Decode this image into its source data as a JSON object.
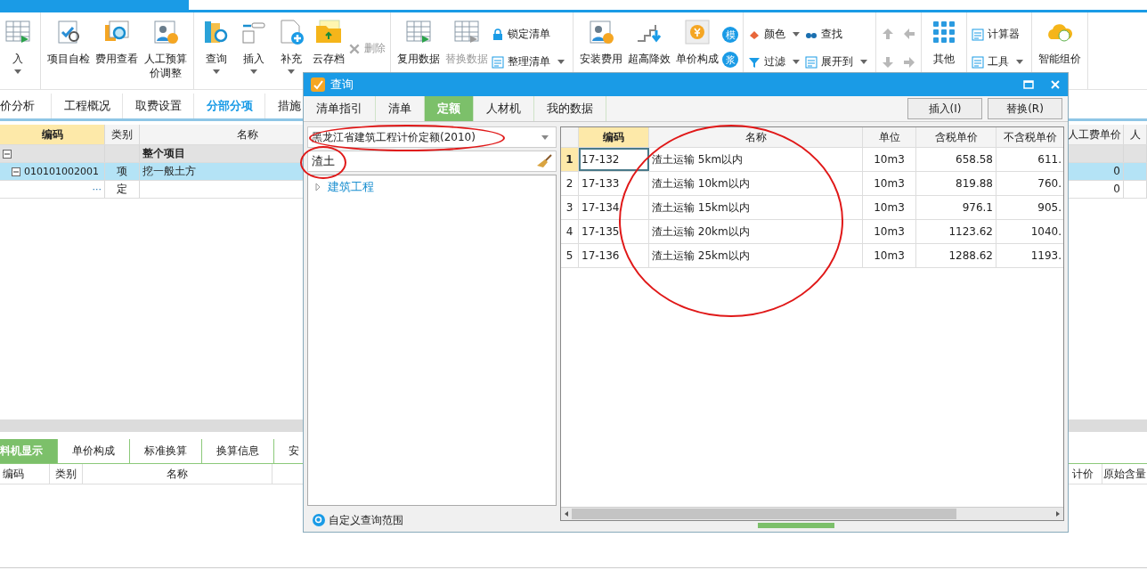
{
  "ribbon": {
    "groups": [
      {
        "items": [
          {
            "kind": "large",
            "label": "入",
            "dropdown": true,
            "disabled": false
          }
        ]
      },
      {
        "items": [
          {
            "kind": "large",
            "label": "项目自检",
            "dropdown": false,
            "disabled": false
          },
          {
            "kind": "large",
            "label": "费用查看",
            "dropdown": false,
            "disabled": false
          },
          {
            "kind": "large",
            "label": "人工预算价调整",
            "dropdown": false,
            "disabled": false
          }
        ]
      },
      {
        "items": [
          {
            "kind": "large",
            "label": "查询",
            "dropdown": true,
            "disabled": false
          },
          {
            "kind": "large",
            "label": "插入",
            "dropdown": true,
            "disabled": false
          },
          {
            "kind": "large",
            "label": "补充",
            "dropdown": true,
            "disabled": false
          },
          {
            "kind": "large",
            "label": "云存档",
            "dropdown": false,
            "disabled": false
          },
          {
            "kind": "small",
            "label": "删除",
            "disabled": true
          }
        ]
      },
      {
        "items": [
          {
            "kind": "large",
            "label": "复用数据",
            "dropdown": false,
            "disabled": false
          },
          {
            "kind": "large",
            "label": "替换数据",
            "dropdown": false,
            "disabled": true
          },
          {
            "kind": "stack",
            "buttons": [
              {
                "label": "锁定清单",
                "dropdown": false
              },
              {
                "label": "整理清单",
                "dropdown": true
              }
            ]
          }
        ]
      },
      {
        "items": [
          {
            "kind": "large",
            "label": "安装费用",
            "dropdown": false,
            "disabled": false
          },
          {
            "kind": "large",
            "label": "超高降效",
            "dropdown": false,
            "disabled": false
          },
          {
            "kind": "large",
            "label": "单价构成",
            "dropdown": false,
            "disabled": false
          },
          {
            "kind": "badges",
            "marks": [
              "模",
              "浆"
            ]
          }
        ]
      },
      {
        "items": [
          {
            "kind": "stack",
            "buttons": [
              {
                "label": "颜色",
                "dropdown": true
              },
              {
                "label": "过滤",
                "dropdown": true
              }
            ]
          },
          {
            "kind": "stack",
            "buttons": [
              {
                "label": "查找",
                "dropdown": false
              },
              {
                "label": "展开到",
                "dropdown": true
              }
            ]
          }
        ]
      },
      {
        "items": [
          {
            "kind": "arrows"
          }
        ]
      },
      {
        "items": [
          {
            "kind": "large",
            "label": "其他",
            "dropdown": false,
            "disabled": false
          }
        ]
      },
      {
        "items": [
          {
            "kind": "stack",
            "buttons": [
              {
                "label": "计算器",
                "dropdown": false
              },
              {
                "label": "工具",
                "dropdown": true
              }
            ]
          }
        ]
      },
      {
        "items": [
          {
            "kind": "large",
            "label": "智能组价",
            "dropdown": false,
            "disabled": false
          }
        ]
      }
    ]
  },
  "tabs": [
    {
      "label": "价分析",
      "selected": false
    },
    {
      "label": "工程概况",
      "selected": false
    },
    {
      "label": "取费设置",
      "selected": false
    },
    {
      "label": "分部分项",
      "selected": true
    },
    {
      "label": "措施",
      "selected": false
    }
  ],
  "grid": {
    "columns": [
      "编码",
      "类别",
      "名称",
      "人工费单价",
      "人"
    ],
    "rows": [
      {
        "kind": "root",
        "name": "整个项目",
        "expanded": true,
        "selected": false
      },
      {
        "kind": "item",
        "code": "010101002001",
        "type": "项",
        "name": "挖一般土方",
        "labor": "0",
        "expanded": true,
        "selected": true
      },
      {
        "kind": "quota",
        "code": "···",
        "type": "定",
        "labor": "0",
        "selected": false
      }
    ]
  },
  "bottom_tabs": [
    {
      "label": "料机显示",
      "selected": true
    },
    {
      "label": "单价构成",
      "selected": false
    },
    {
      "label": "标准换算",
      "selected": false
    },
    {
      "label": "换算信息",
      "selected": false
    },
    {
      "label": "安",
      "selected": false
    }
  ],
  "bottom_grid": {
    "columns": [
      "编码",
      "类别",
      "名称"
    ],
    "right_columns": [
      "计价",
      "原始含量"
    ]
  },
  "dialog": {
    "title": "查询",
    "tabs": [
      {
        "label": "清单指引",
        "selected": false
      },
      {
        "label": "清单",
        "selected": false
      },
      {
        "label": "定额",
        "selected": true
      },
      {
        "label": "人材机",
        "selected": false
      },
      {
        "label": "我的数据",
        "selected": false
      }
    ],
    "buttons": [
      "插入(I)",
      "替换(R)"
    ],
    "library": "黑龙江省建筑工程计价定额(2010)",
    "search": {
      "value": "渣土"
    },
    "tree": [
      {
        "label": "建筑工程",
        "expanded": false
      }
    ],
    "scope_link": "自定义查询范围",
    "results": {
      "columns": [
        "编码",
        "名称",
        "单位",
        "含税单价",
        "不含税单价"
      ],
      "rows": [
        {
          "num": "1",
          "code": "17-132",
          "name": "渣土运输 5km以内",
          "unit": "10m3",
          "tax_price": "658.58",
          "net_price": "611.",
          "selected": true
        },
        {
          "num": "2",
          "code": "17-133",
          "name": "渣土运输 10km以内",
          "unit": "10m3",
          "tax_price": "819.88",
          "net_price": "760.",
          "selected": false
        },
        {
          "num": "3",
          "code": "17-134",
          "name": "渣土运输 15km以内",
          "unit": "10m3",
          "tax_price": "976.1",
          "net_price": "905.",
          "selected": false
        },
        {
          "num": "4",
          "code": "17-135",
          "name": "渣土运输 20km以内",
          "unit": "10m3",
          "tax_price": "1123.62",
          "net_price": "1040.",
          "selected": false
        },
        {
          "num": "5",
          "code": "17-136",
          "name": "渣土运输 25km以内",
          "unit": "10m3",
          "tax_price": "1288.62",
          "net_price": "1193.",
          "selected": false
        }
      ]
    },
    "markup": {
      "circled_library": true,
      "circled_search": true,
      "circled_names": true
    }
  }
}
